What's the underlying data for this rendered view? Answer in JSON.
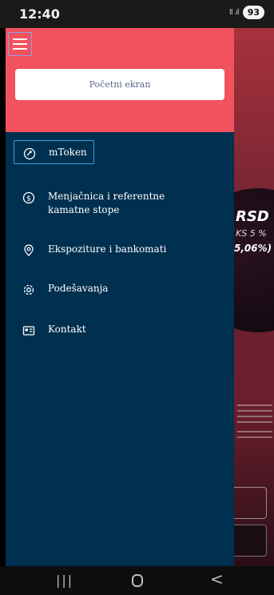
{
  "status_bar": {
    "time": "12:40",
    "signal": "Ⅱ .ıl",
    "battery": "93"
  },
  "background_app": {
    "currency": "RSD",
    "ks_text": "KS 5 %",
    "rate_text": "5,06%)"
  },
  "drawer": {
    "home_button_label": "Početni ekran",
    "items": [
      {
        "label": "mToken",
        "icon": "token-icon",
        "selected": true
      },
      {
        "label": "Menjačnica i referentne kamatne stope",
        "icon": "dollar-icon",
        "selected": false
      },
      {
        "label": "Ekspoziture i bankomati",
        "icon": "location-icon",
        "selected": false
      },
      {
        "label": "Podešavanja",
        "icon": "gear-icon",
        "selected": false
      },
      {
        "label": "Kontakt",
        "icon": "contact-card-icon",
        "selected": false
      }
    ]
  },
  "colors": {
    "header": "#f2525e",
    "drawer": "#00304f",
    "selected_border": "#3aa0e6"
  }
}
